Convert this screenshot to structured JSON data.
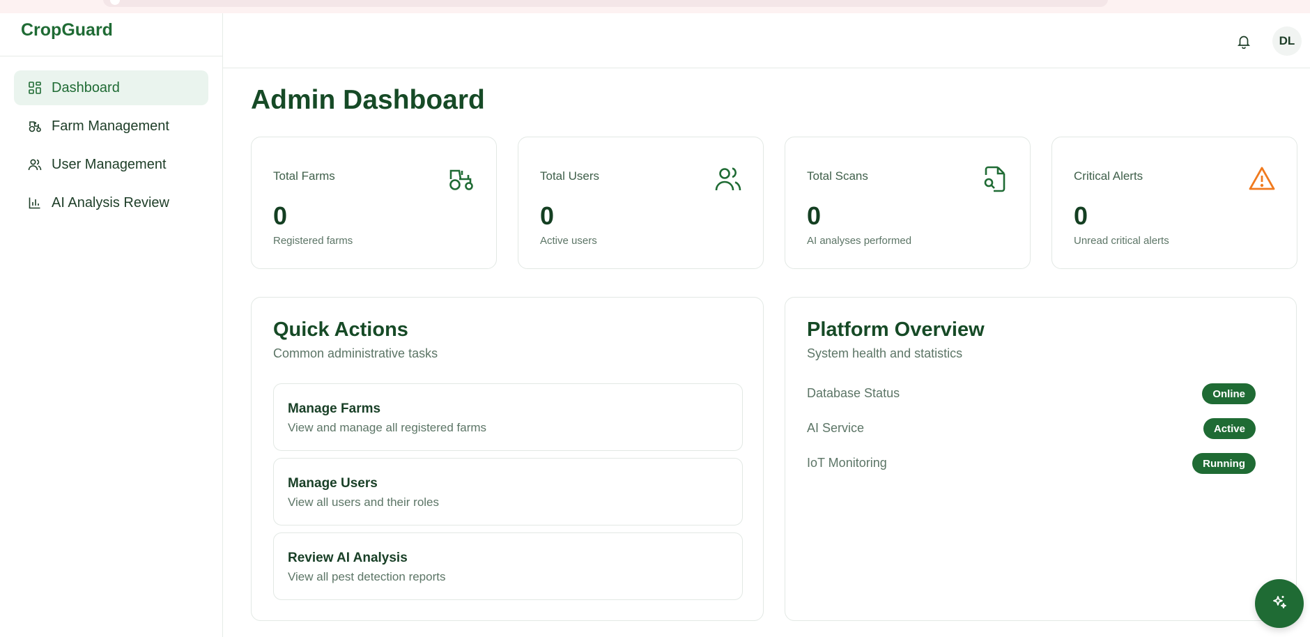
{
  "app": {
    "brand": "CropGuard"
  },
  "sidebar": {
    "items": [
      {
        "label": "Dashboard",
        "icon": "dashboard-grid-icon",
        "active": true
      },
      {
        "label": "Farm Management",
        "icon": "tractor-icon",
        "active": false
      },
      {
        "label": "User Management",
        "icon": "users-icon",
        "active": false
      },
      {
        "label": "AI Analysis Review",
        "icon": "bar-chart-icon",
        "active": false
      }
    ]
  },
  "header": {
    "avatar_initials": "DL",
    "bell_icon": "bell-icon"
  },
  "page": {
    "title": "Admin Dashboard"
  },
  "stats": [
    {
      "label": "Total Farms",
      "value": "0",
      "sub": "Registered farms",
      "icon": "tractor-icon",
      "color": "#1f6b34"
    },
    {
      "label": "Total Users",
      "value": "0",
      "sub": "Active users",
      "icon": "users-icon",
      "color": "#1f6b34"
    },
    {
      "label": "Total Scans",
      "value": "0",
      "sub": "AI analyses performed",
      "icon": "file-search-icon",
      "color": "#1f6b34"
    },
    {
      "label": "Critical Alerts",
      "value": "0",
      "sub": "Unread critical alerts",
      "icon": "warning-triangle-icon",
      "color": "#f07a1e"
    }
  ],
  "quick_actions": {
    "title": "Quick Actions",
    "subtitle": "Common administrative tasks",
    "items": [
      {
        "title": "Manage Farms",
        "desc": "View and manage all registered farms"
      },
      {
        "title": "Manage Users",
        "desc": "View all users and their roles"
      },
      {
        "title": "Review AI Analysis",
        "desc": "View all pest detection reports"
      }
    ]
  },
  "platform": {
    "title": "Platform Overview",
    "subtitle": "System health and statistics",
    "rows": [
      {
        "label": "Database Status",
        "status": "Online"
      },
      {
        "label": "AI Service",
        "status": "Active"
      },
      {
        "label": "IoT Monitoring",
        "status": "Running"
      }
    ]
  },
  "fab": {
    "icon": "sparkles-icon"
  },
  "colors": {
    "brand": "#1f6b34",
    "accent_light": "#eaf4ee",
    "alert": "#f07a1e"
  }
}
